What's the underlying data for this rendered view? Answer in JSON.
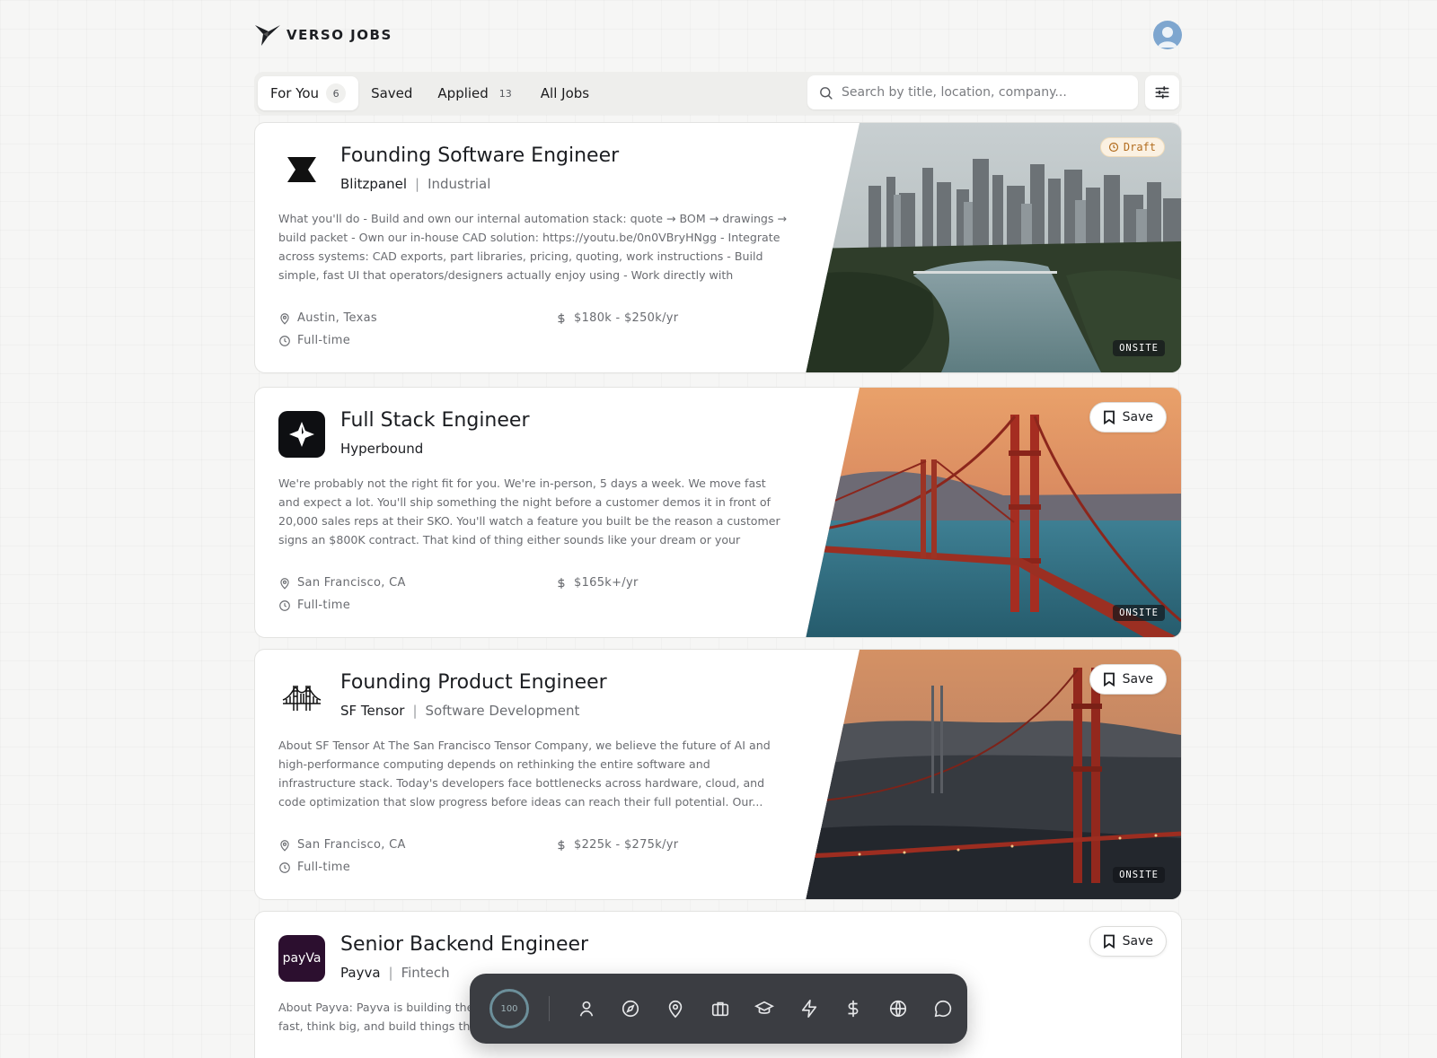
{
  "brand": {
    "name": "VERSO JOBS"
  },
  "tabs": [
    {
      "label": "For You",
      "count": "6",
      "active": true
    },
    {
      "label": "Saved",
      "count": "",
      "active": false
    },
    {
      "label": "Applied",
      "count": "13",
      "active": false
    },
    {
      "label": "All Jobs",
      "count": "",
      "active": false
    }
  ],
  "search": {
    "placeholder": "Search by title, location, company...",
    "value": ""
  },
  "jobs": [
    {
      "title": "Founding Software Engineer",
      "company": "Blitzpanel",
      "industry": "Industrial",
      "description": "What you'll do - Build and own our internal automation stack: quote → BOM → drawings → build packet - Own our in-house CAD solution: https://youtu.be/0n0VBryHNgg - Integrate across systems: CAD exports, part libraries, pricing, quoting, work instructions - Build simple, fast UI that operators/designers actually enjoy using - Work directly with founder...",
      "location": "Austin, Texas",
      "salary": "$180k - $250k/yr",
      "type": "Full-time",
      "badge": "ONSITE",
      "status": "Draft",
      "save_label": ""
    },
    {
      "title": "Full Stack Engineer",
      "company": "Hyperbound",
      "industry": "",
      "description": "We're probably not the right fit for you. We're in-person, 5 days a week. We move fast and expect a lot. You'll ship something the night before a customer demos it in front of 20,000 sales reps at their SKO. You'll watch a feature you built be the reason a customer signs an $800K contract. That kind of thing either sounds like your dream or your nightmare. If it's...",
      "location": "San Francisco, CA",
      "salary": "$165k+/yr",
      "type": "Full-time",
      "badge": "ONSITE",
      "save_label": "Save"
    },
    {
      "title": "Founding Product Engineer",
      "company": "SF Tensor",
      "industry": "Software Development",
      "description": "About SF Tensor At The San Francisco Tensor Company, we believe the future of AI and high-performance computing depends on rethinking the entire software and infrastructure stack. Today's developers face bottlenecks across hardware, cloud, and code optimization that slow progress before ideas can reach their full potential. Our...",
      "location": "San Francisco, CA",
      "salary": "$225k - $275k/yr",
      "type": "Full-time",
      "badge": "ONSITE",
      "save_label": "Save"
    },
    {
      "title": "Senior Backend Engineer",
      "company": "Payva",
      "industry": "Fintech",
      "logo_text": "payVa",
      "description": "About Payva: Payva is building the ... connecting digital entrepreneurs ... tools. We move fast, think big, and build things that go live weekly, not quarterly. We're",
      "save_label": "Save"
    }
  ],
  "dock": {
    "score": "100",
    "icons": [
      "user-icon",
      "compass-icon",
      "map-pin-icon",
      "briefcase-icon",
      "graduation-cap-icon",
      "lightning-icon",
      "dollar-icon",
      "globe-icon",
      "chat-bubble-icon"
    ]
  },
  "colors": {
    "accent": "#1b1d21",
    "draft": "#b26c1e",
    "payva_logo_bg": "#2c0f2f"
  }
}
